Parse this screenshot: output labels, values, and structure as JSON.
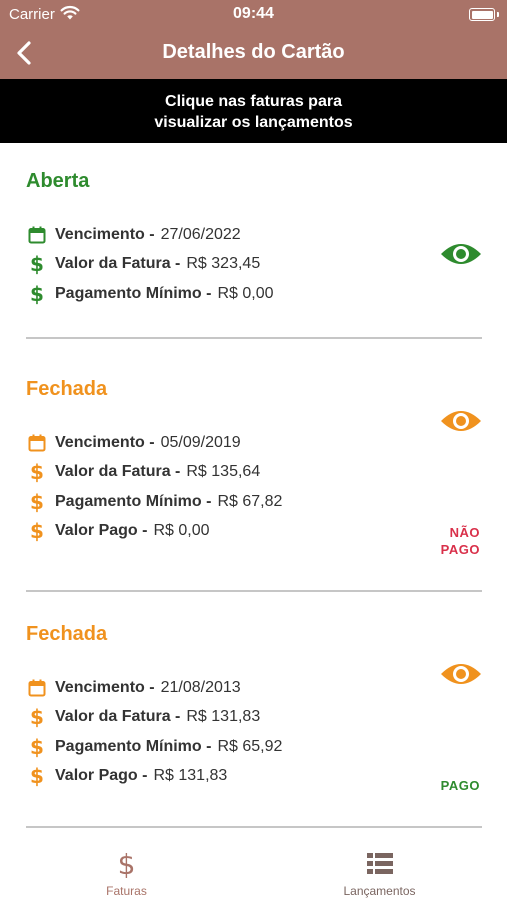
{
  "status_bar": {
    "carrier": "Carrier",
    "time": "09:44"
  },
  "nav": {
    "title": "Detalhes do Cartão"
  },
  "banner": {
    "line1": "Clique nas faturas para",
    "line2": "visualizar os lançamentos"
  },
  "labels": {
    "vencimento": "Vencimento -",
    "valor_fatura": "Valor da Fatura -",
    "pagamento_minimo": "Pagamento Mínimo -",
    "valor_pago": "Valor Pago -"
  },
  "invoices": [
    {
      "status": "Aberta",
      "color": "#2e8b2e",
      "vencimento": "27/06/2022",
      "valor_fatura": "R$ 323,45",
      "pagamento_minimo": "R$ 0,00"
    },
    {
      "status": "Fechada",
      "color": "#f0921e",
      "vencimento": "05/09/2019",
      "valor_fatura": "R$ 135,64",
      "pagamento_minimo": "R$ 67,82",
      "valor_pago": "R$ 0,00",
      "badge_line1": "NÃO",
      "badge_line2": "PAGO",
      "badge_color": "#d9304a"
    },
    {
      "status": "Fechada",
      "color": "#f0921e",
      "vencimento": "21/08/2013",
      "valor_fatura": "R$ 131,83",
      "pagamento_minimo": "R$ 65,92",
      "valor_pago": "R$ 131,83",
      "badge_line1": "PAGO",
      "badge_color": "#2e8b2e"
    }
  ],
  "tabs": [
    {
      "label": "Faturas",
      "icon": "dollar-icon",
      "active": true
    },
    {
      "label": "Lançamentos",
      "icon": "list-icon",
      "active": false
    }
  ],
  "colors": {
    "brand": "#a97368",
    "open": "#2e8b2e",
    "closed": "#f0921e",
    "unpaid": "#d9304a",
    "tab_inactive": "#7a6560"
  }
}
